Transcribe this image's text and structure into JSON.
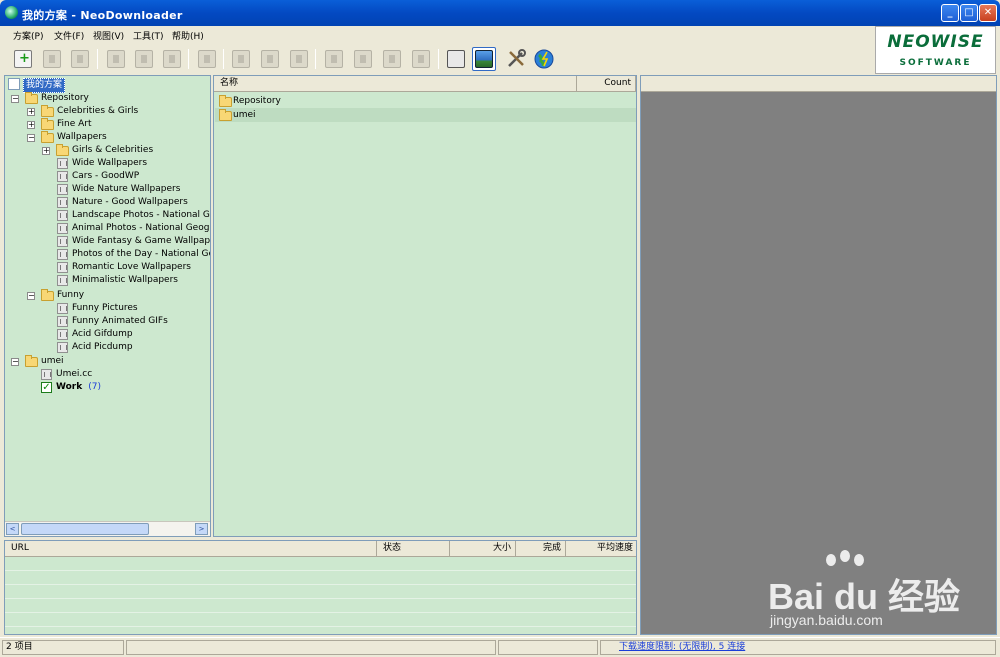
{
  "window": {
    "title": "我的方案 - NeoDownloader",
    "min_glyph": "_",
    "max_glyph": "□",
    "close_glyph": "✕"
  },
  "menu": [
    "方案(P)",
    "文件(F)",
    "视图(V)",
    "工具(T)",
    "帮助(H)"
  ],
  "logo": {
    "top": "NEOWISE",
    "bottom": "SOFTWARE"
  },
  "tree": {
    "root": "我的方案",
    "repository": "Repository",
    "celebrities_girls": "Celebrities & Girls",
    "fine_art": "Fine Art",
    "wallpapers": "Wallpapers",
    "girls_celebrities": "Girls & Celebrities",
    "wide_wallpapers": "Wide Wallpapers",
    "cars_goodwp": "Cars - GoodWP",
    "wide_nature": "Wide Nature Wallpapers",
    "nature_good": "Nature - Good Wallpapers",
    "landscape_ng": "Landscape Photos - National Geogr",
    "animal_ng": "Animal Photos - National Geograph",
    "wide_fantasy": "Wide Fantasy & Game Wallpapers",
    "photos_day_ng": "Photos of the Day - National Geogr",
    "romantic": "Romantic Love Wallpapers",
    "minimalistic": "Minimalistic Wallpapers",
    "funny": "Funny",
    "funny_pictures": "Funny Pictures",
    "funny_gifs": "Funny Animated GIFs",
    "acid_gifdump": "Acid Gifdump",
    "acid_picdump": "Acid Picdump",
    "umei": "umei",
    "umei_cc": "Umei.cc",
    "work": "Work",
    "work_count": "(7)"
  },
  "expander": {
    "plus": "+",
    "minus": "−"
  },
  "scroll": {
    "left": "<",
    "right": ">"
  },
  "list": {
    "col_name": "名称",
    "col_count": "Count",
    "rows": [
      "Repository",
      "umei"
    ]
  },
  "downloads": {
    "col_url": "URL",
    "col_status": "状态",
    "col_size": "大小",
    "col_done": "完成",
    "col_speed": "平均速度"
  },
  "status": {
    "items": "2 项目",
    "speed_link": "下载速度限制: (无限制), 5 连接"
  },
  "watermark": {
    "main": "Bai  du 经验",
    "sub": "jingyan.baidu.com"
  }
}
